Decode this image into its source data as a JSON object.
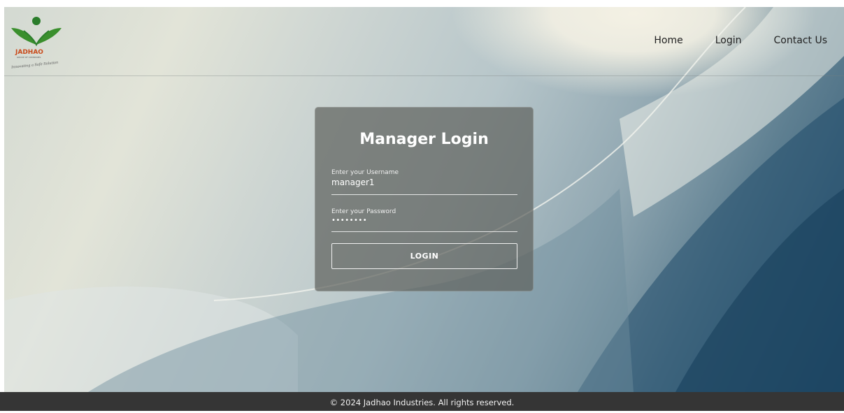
{
  "brand": {
    "logo_text": "JADHAO",
    "logo_subtext": "GROUP OF COMPANIES",
    "logo_tagline": "Innovating a Safe Solution",
    "colors": {
      "leaf": "#3a8f2d",
      "text": "#c94a1a",
      "dot": "#2b7d2b"
    }
  },
  "nav": {
    "items": [
      {
        "label": "Home"
      },
      {
        "label": "Login"
      },
      {
        "label": "Contact Us"
      }
    ]
  },
  "login": {
    "title": "Manager Login",
    "username": {
      "label": "Enter your Username",
      "value": "manager1"
    },
    "password": {
      "label": "Enter your Password",
      "value": "••••••••"
    },
    "button_label": "LOGIN"
  },
  "footer": {
    "text": "© 2024 Jadhao Industries. All rights reserved."
  }
}
